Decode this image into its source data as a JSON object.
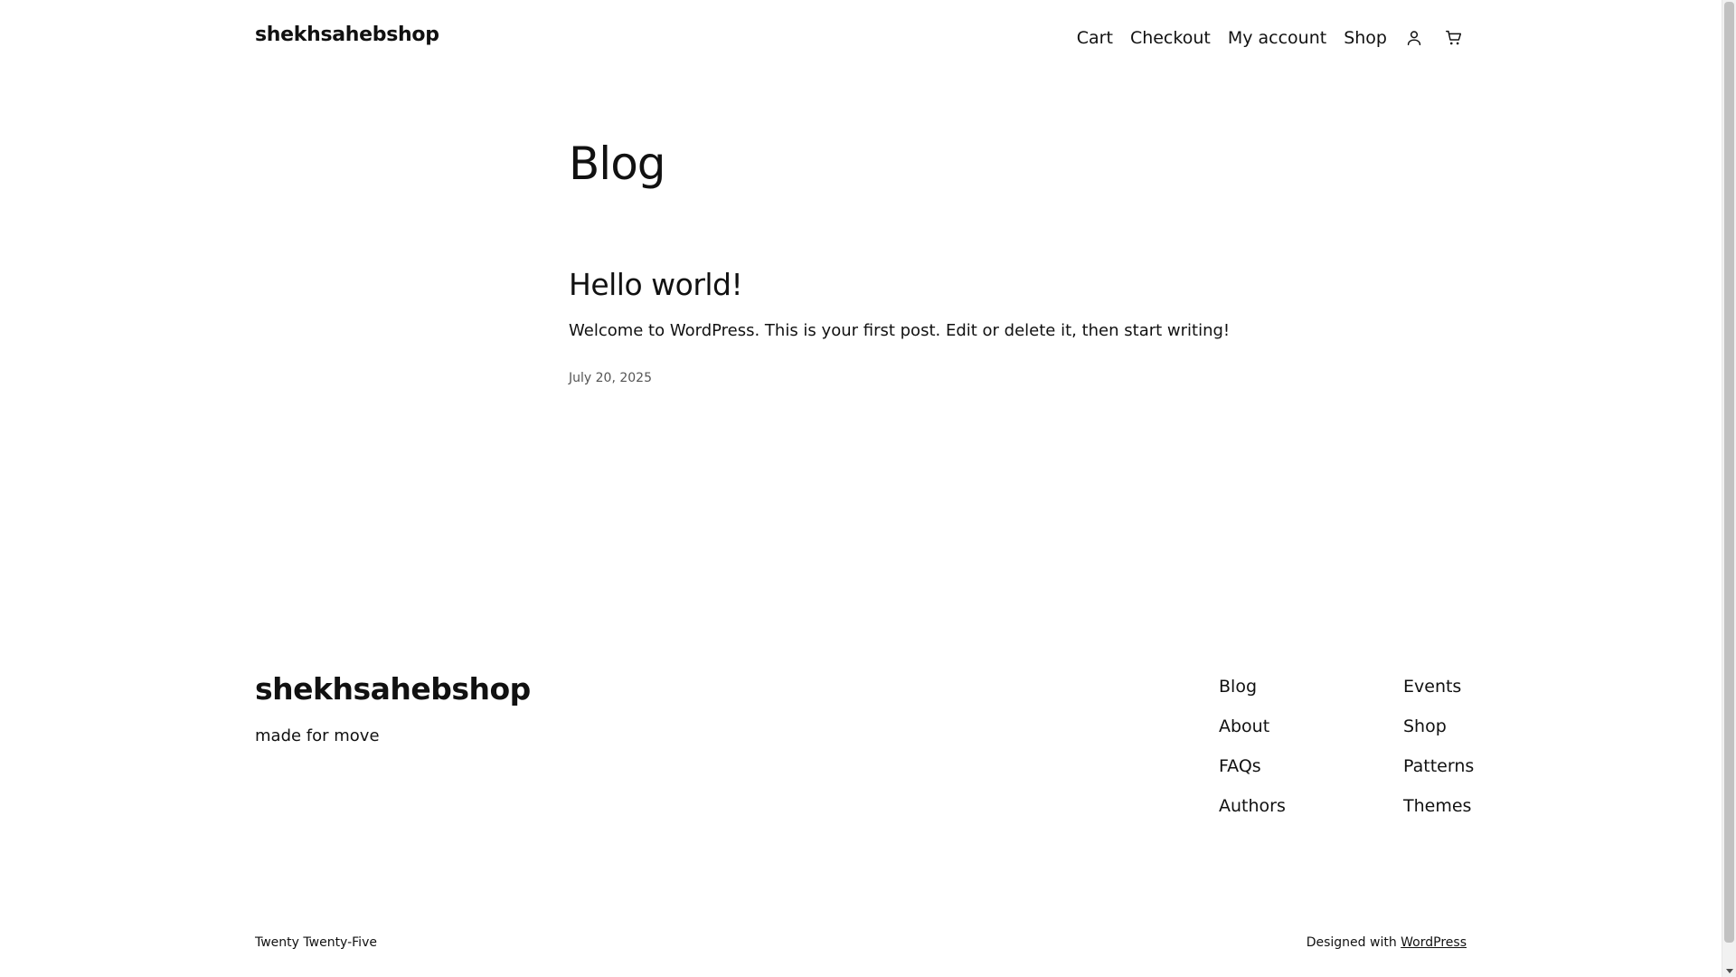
{
  "header": {
    "site_title": "shekhsahebshop",
    "nav": [
      {
        "label": "Cart"
      },
      {
        "label": "Checkout"
      },
      {
        "label": "My account"
      },
      {
        "label": "Shop"
      }
    ],
    "account_icon": "user-icon",
    "cart_icon": "cart-icon"
  },
  "main": {
    "page_title": "Blog",
    "posts": [
      {
        "title": "Hello world!",
        "excerpt": "Welcome to WordPress. This is your first post. Edit or delete it, then start writing!",
        "date": "July 20, 2025"
      }
    ]
  },
  "footer": {
    "site_title": "shekhsahebshop",
    "tagline": "made for move",
    "links_col1": [
      "Blog",
      "About",
      "FAQs",
      "Authors"
    ],
    "links_col2": [
      "Events",
      "Shop",
      "Patterns",
      "Themes"
    ],
    "theme_credit": "Twenty Twenty-Five",
    "designed_with_prefix": "Designed with",
    "designed_with_link": "WordPress"
  }
}
